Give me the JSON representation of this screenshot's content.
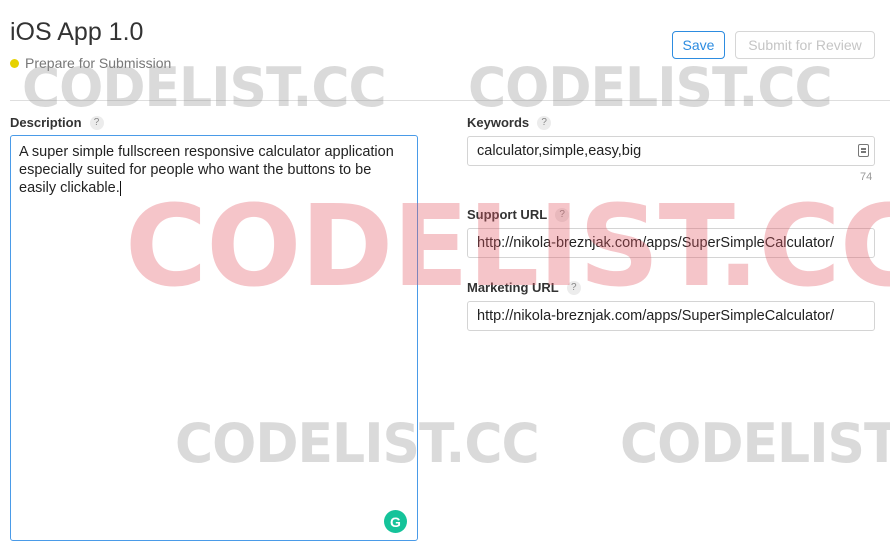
{
  "header": {
    "title": "iOS App 1.0",
    "status": "Prepare for Submission",
    "status_color": "#e6d200",
    "save_label": "Save",
    "submit_label": "Submit for Review"
  },
  "description": {
    "label": "Description",
    "help": "?",
    "value": "A super simple fullscreen responsive calculator application especially suited for people who want the buttons to be easily clickable."
  },
  "keywords": {
    "label": "Keywords",
    "help": "?",
    "value": "calculator,simple,easy,big",
    "remaining": "74"
  },
  "support_url": {
    "label": "Support URL",
    "help": "?",
    "value": "http://nikola-breznjak.com/apps/SuperSimpleCalculator/"
  },
  "marketing_url": {
    "label": "Marketing URL",
    "help": "?",
    "value": "http://nikola-breznjak.com/apps/SuperSimpleCalculator/"
  },
  "watermark": {
    "text": "CODELIST.CC"
  },
  "colors": {
    "accent": "#2d8ce0",
    "grammarly": "#15c39a"
  },
  "icons": {
    "grammarly": "grammarly-icon",
    "keywords_field": "contact-card-icon"
  }
}
